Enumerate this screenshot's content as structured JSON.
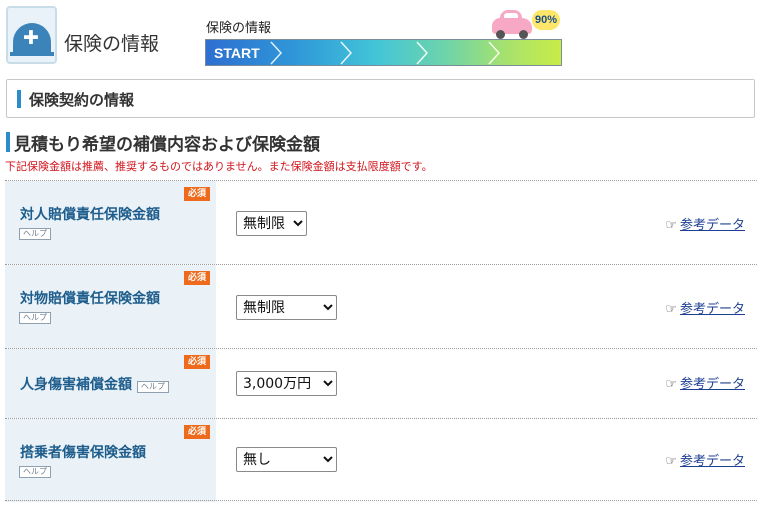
{
  "header": {
    "icon": "insurance-plus-icon",
    "title": "保険の情報",
    "progress_label": "保険の情報",
    "progress_start": "START",
    "progress_percent_label": "90%",
    "progress_value": 90
  },
  "section": {
    "title": "保険契約の情報"
  },
  "coverage": {
    "title": "見積もり希望の補償内容および保険金額",
    "note": "下記保険金額は推薦、推奨するものではありません。また保険金額は支払限度額です。"
  },
  "rows": [
    {
      "label": "対人賠償責任保険金額",
      "required": "必須",
      "help": "ヘルプ",
      "value": "無制限",
      "ref": "参考データ"
    },
    {
      "label": "対物賠償責任保険金額",
      "required": "必須",
      "help": "ヘルプ",
      "value": "無制限",
      "ref": "参考データ"
    },
    {
      "label": "人身傷害補償金額",
      "required": "必須",
      "help": "ヘルプ",
      "value": "3,000万円",
      "ref": "参考データ"
    },
    {
      "label": "搭乗者傷害保険金額",
      "required": "必須",
      "help": "ヘルプ",
      "value": "無し",
      "ref": "参考データ"
    }
  ],
  "colors": {
    "accent": "#2b8ccc",
    "required_badge": "#ee6a1c",
    "note_red": "#d0141b",
    "label_blue": "#1e5d8c"
  }
}
